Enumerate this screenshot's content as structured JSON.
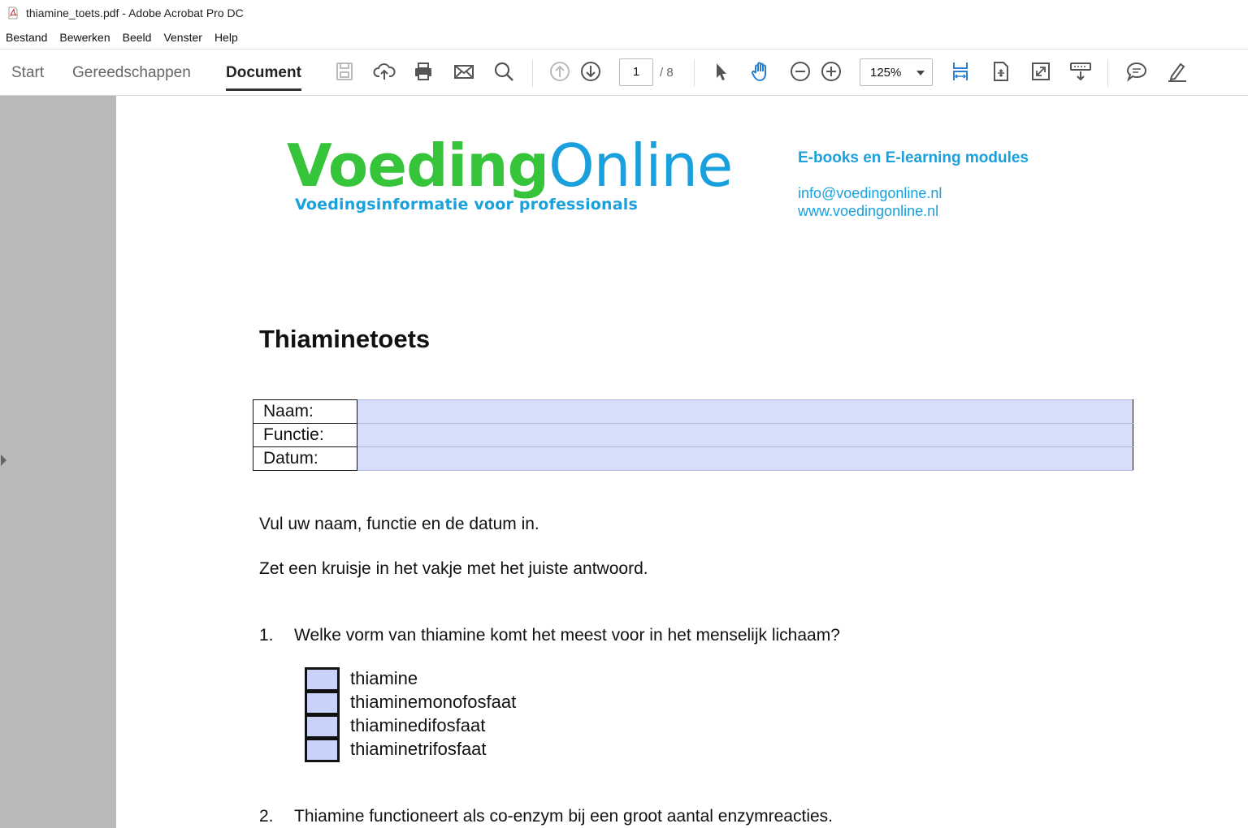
{
  "window": {
    "title": "thiamine_toets.pdf - Adobe Acrobat Pro DC"
  },
  "menu": [
    "Bestand",
    "Bewerken",
    "Beeld",
    "Venster",
    "Help"
  ],
  "nav_tabs": [
    {
      "label": "Start",
      "active": false
    },
    {
      "label": "Gereedschappen",
      "active": false
    },
    {
      "label": "Document",
      "active": true
    }
  ],
  "tools": {
    "save": "save-icon",
    "upload": "cloud-upload-icon",
    "print": "printer-icon",
    "email": "envelope-icon",
    "search": "search-icon",
    "prev_page": "arrow-up-circle-icon",
    "next_page": "arrow-down-circle-icon",
    "select": "pointer-icon",
    "hand": "hand-icon",
    "zoom_out": "minus-circle-icon",
    "zoom_in": "plus-circle-icon",
    "fit_width": "fit-width-icon",
    "rotate": "rotate-page-icon",
    "fullscreen": "full-screen-icon",
    "read_mode": "read-mode-icon",
    "comment": "comment-icon",
    "highlight": "highlight-pen-icon"
  },
  "pagination": {
    "current": "1",
    "total": "/ 8"
  },
  "zoom": {
    "value": "125%"
  },
  "colors": {
    "brand_green": "#35c43a",
    "brand_blue": "#1aa0dc",
    "field_fill": "#d6defa",
    "accent_tool": "#2a7fd4"
  },
  "document": {
    "logo": {
      "part1": "Voeding",
      "part2": "Online",
      "tagline": "Voedingsinformatie voor professionals"
    },
    "contact": {
      "heading": "E-books en E-learning modules",
      "email": "info@voedingonline.nl",
      "website": "www.voedingonline.nl"
    },
    "title": "Thiaminetoets",
    "form": [
      {
        "label": "Naam:",
        "value": ""
      },
      {
        "label": "Functie:",
        "value": ""
      },
      {
        "label": "Datum:",
        "value": ""
      }
    ],
    "instructions": [
      "Vul uw naam, functie en de datum in.",
      "Zet een kruisje in het vakje met het juiste antwoord."
    ],
    "questions": [
      {
        "number": "1.",
        "text": "Welke vorm van thiamine komt het meest voor in het menselijk lichaam?",
        "options": [
          "thiamine",
          "thiaminemonofosfaat",
          "thiaminedifosfaat",
          "thiaminetrifosfaat"
        ]
      },
      {
        "number": "2.",
        "text": "Thiamine functioneert als co-enzym bij een groot aantal enzymreacties."
      }
    ]
  }
}
